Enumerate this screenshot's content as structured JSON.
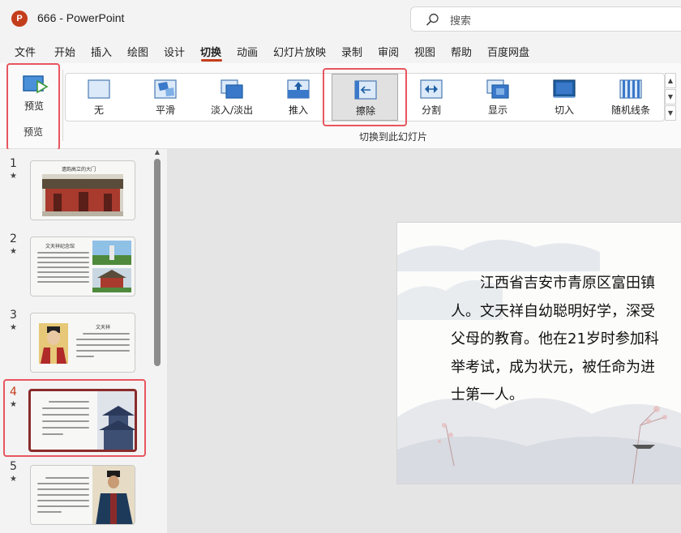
{
  "window": {
    "title": "666  -  PowerPoint",
    "app_logo": "P"
  },
  "search": {
    "label": "搜索"
  },
  "tabs": [
    "文件",
    "开始",
    "插入",
    "绘图",
    "设计",
    "切换",
    "动画",
    "幻灯片放映",
    "录制",
    "审阅",
    "视图",
    "帮助",
    "百度网盘"
  ],
  "active_tab": "切换",
  "ribbon": {
    "preview_button": "预览",
    "preview_group": "预览",
    "effects": [
      {
        "label": "无",
        "icon": "none-icon"
      },
      {
        "label": "平滑",
        "icon": "morph-icon"
      },
      {
        "label": "淡入/淡出",
        "icon": "fade-icon"
      },
      {
        "label": "推入",
        "icon": "push-icon"
      },
      {
        "label": "擦除",
        "icon": "wipe-icon",
        "selected": true
      },
      {
        "label": "分割",
        "icon": "split-icon"
      },
      {
        "label": "显示",
        "icon": "reveal-icon"
      },
      {
        "label": "切入",
        "icon": "cut-icon"
      },
      {
        "label": "随机线条",
        "icon": "random-bars-icon"
      }
    ],
    "gallery_group": "切换到此幻灯片"
  },
  "slides": [
    {
      "num": "1",
      "star": "★",
      "title": "遗韵高立的大门"
    },
    {
      "num": "2",
      "star": "★",
      "title": "文天祥纪念馆"
    },
    {
      "num": "3",
      "star": "★",
      "title": "文天祥"
    },
    {
      "num": "4",
      "star": "★"
    },
    {
      "num": "5",
      "star": "★"
    }
  ],
  "active_slide": "4",
  "main_slide": {
    "lines": [
      "江西省吉安市青原区富田镇",
      "人。文天祥自幼聪明好学，深受",
      "父母的教育。他在21岁时参加科",
      "举考试，成为状元，被任命为进",
      "士第一人。"
    ]
  },
  "colors": {
    "accent": "#c43e1c",
    "highlight": "#e8565f",
    "selected_thumb": "#8a2b2b"
  }
}
